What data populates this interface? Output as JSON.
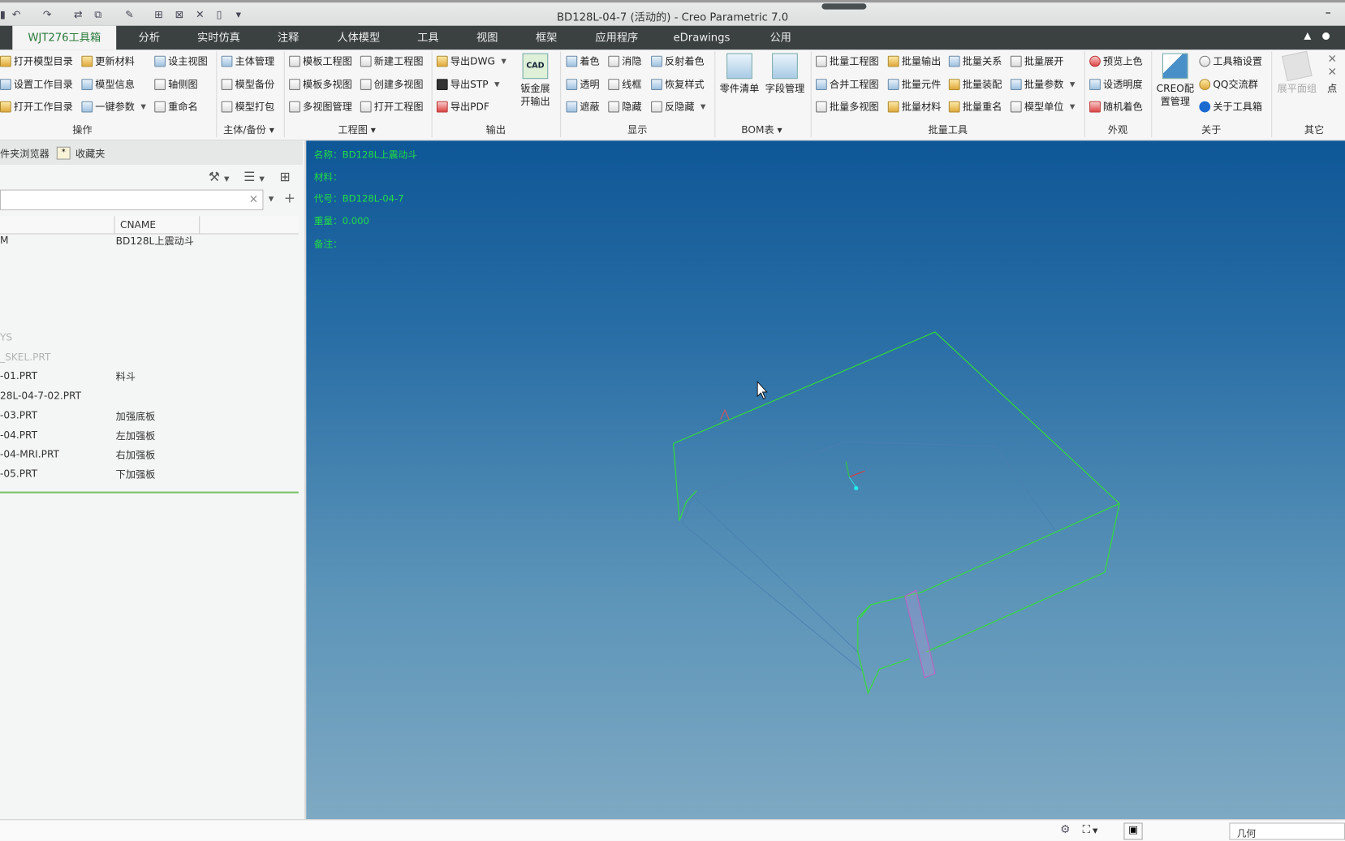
{
  "window": {
    "title": "BD128L-04-7 (活动的) - Creo Parametric 7.0",
    "minimize": "–"
  },
  "quick_access": [
    "↶",
    "↷",
    "⇄",
    "⧉",
    "✎",
    "⊞",
    "⊠",
    "✕",
    "▯",
    "▾"
  ],
  "tabs": [
    "WJT276工具箱",
    "分析",
    "实时仿真",
    "注释",
    "人体模型",
    "工具",
    "视图",
    "框架",
    "应用程序",
    "eDrawings",
    "公用"
  ],
  "ribbon": {
    "caozuo": {
      "label": "操作",
      "items": [
        "打开模型目录",
        "设置工作目录",
        "打开工作目录",
        "更新材料",
        "模型信息",
        "一键参数",
        "设主视图",
        "轴侧图",
        "重命名"
      ]
    },
    "zhuti": {
      "label": "主体/备份 ▾",
      "items": [
        "主体管理",
        "模型备份",
        "模型打包"
      ]
    },
    "gongchengtu": {
      "label": "工程图 ▾",
      "items": [
        "模板工程图",
        "模板多视图",
        "多视图管理",
        "新建工程图",
        "创建多视图",
        "打开工程图"
      ]
    },
    "shuchu": {
      "label": "输出",
      "items": [
        "导出DWG",
        "导出STP",
        "导出PDF"
      ],
      "big": "钣金展开输出",
      "big_icon_text": "CAD"
    },
    "xianshi": {
      "label": "显示",
      "items": [
        "着色",
        "透明",
        "遮蔽",
        "消隐",
        "线框",
        "隐藏",
        "反射着色",
        "恢复样式",
        "反隐藏"
      ]
    },
    "bom": {
      "label": "BOM表 ▾",
      "big": [
        "零件清单",
        "字段管理"
      ]
    },
    "piliang": {
      "label": "批量工具",
      "items": [
        "批量工程图",
        "合并工程图",
        "批量多视图",
        "批量输出",
        "批量元件",
        "批量材料",
        "批量关系",
        "批量装配",
        "批量重名",
        "批量展开",
        "批量参数",
        "模型单位"
      ]
    },
    "waiguan": {
      "label": "外观",
      "items": [
        "预览上色",
        "设透明度",
        "随机着色"
      ]
    },
    "guanyu": {
      "label": "关于",
      "big": "CREO配置管理",
      "items": [
        "工具箱设置",
        "QQ交流群",
        "关于工具箱"
      ]
    },
    "qita": {
      "label": "其它",
      "items": [
        "展平面组",
        "点"
      ]
    }
  },
  "left_panel": {
    "tabs": [
      "件夹浏览器",
      "收藏夹"
    ],
    "search": {
      "value": "",
      "clear": "×",
      "add": "+"
    },
    "columns": [
      "",
      "CNAME"
    ],
    "rows": [
      {
        "name": "M",
        "cname": "BD128L上震动斗",
        "dim": false
      },
      {
        "name": "YS",
        "cname": "",
        "dim": true
      },
      {
        "name": "_SKEL.PRT",
        "cname": "",
        "dim": true
      },
      {
        "name": "-01.PRT",
        "cname": "料斗",
        "dim": false
      },
      {
        "name": "28L-04-7-02.PRT",
        "cname": "",
        "dim": false
      },
      {
        "name": "-03.PRT",
        "cname": "加强底板",
        "dim": false
      },
      {
        "name": "-04.PRT",
        "cname": "左加强板",
        "dim": false
      },
      {
        "name": "-04-MRI.PRT",
        "cname": "右加强板",
        "dim": false
      },
      {
        "name": "-05.PRT",
        "cname": "下加强板",
        "dim": false
      }
    ]
  },
  "model_info": [
    "名称：BD128L上震动斗",
    "材料：",
    "代号：BD128L-04-7",
    "重量：0.000",
    "备注："
  ],
  "status": {
    "filter": "几何"
  },
  "colors": {
    "tabbar": "#3b4040",
    "info_text": "#22dd44",
    "edge": "#33dd33",
    "hidden": "#4a7fb0"
  }
}
